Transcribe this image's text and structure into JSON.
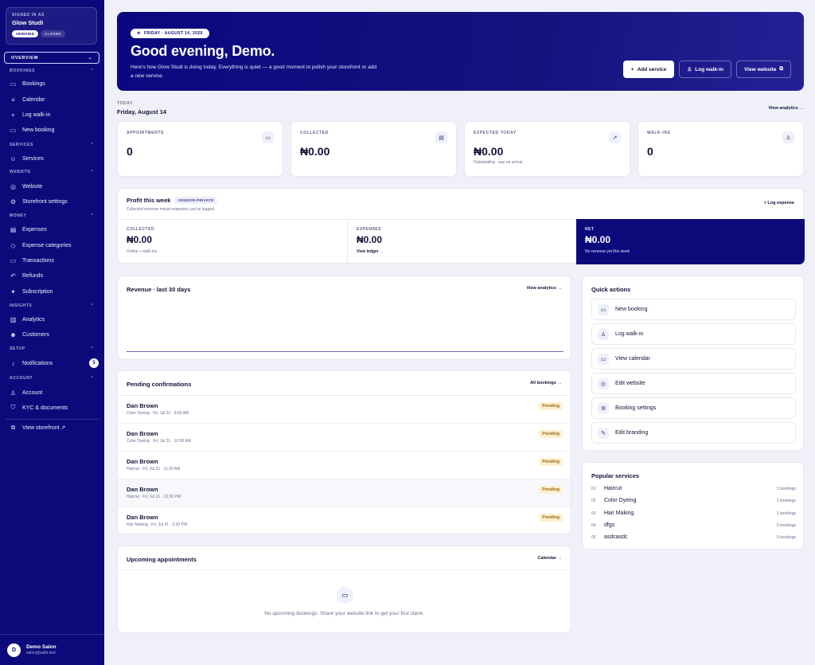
{
  "sidebar": {
    "signed_in_label": "SIGNED IN AS",
    "store_name": "Glow Studi",
    "verified": "VERIFIED",
    "closed": "CLOSED",
    "overview": "OVERVIEW",
    "sections": {
      "bookings": "BOOKINGS",
      "services": "SERVICES",
      "website": "WEBSITE",
      "money": "MONEY",
      "insights": "INSIGHTS",
      "setup": "SETUP",
      "account": "ACCOUNT"
    },
    "items": {
      "bookings": "Bookings",
      "calendar": "Calendar",
      "log_walkin": "Log walk-in",
      "new_booking": "New booking",
      "services": "Services",
      "website": "Website",
      "storefront_settings": "Storefront settings",
      "expenses": "Expenses",
      "expense_categories": "Expense categories",
      "transactions": "Transactions",
      "refunds": "Refunds",
      "subscription": "Subscription",
      "analytics": "Analytics",
      "customers": "Customers",
      "notifications": "Notifications",
      "notifications_count": "5",
      "account": "Account",
      "kyc": "KYC & documents",
      "view_storefront": "View storefront ↗"
    },
    "user": {
      "initial": "D",
      "name": "Demo Salon",
      "email": "salon@salbi.test"
    }
  },
  "hero": {
    "date": "FRIDAY · AUGUST 14, 2026",
    "greeting": "Good evening, Demo.",
    "message": "Here's how Glow Studi is doing today. Everything is quiet — a good moment to polish your storefront or add a new service.",
    "add_service": "Add service",
    "log_walkin": "Log walk-in",
    "view_website": "View website"
  },
  "today": {
    "label": "TODAY",
    "date": "Friday, August 14",
    "view_analytics": "View analytics →"
  },
  "stats": [
    {
      "label": "APPOINTMENTS",
      "value": "0",
      "sub": "",
      "icon": "calendar-icon"
    },
    {
      "label": "COLLECTED",
      "value": "₦0.00",
      "sub": "",
      "icon": "wallet-icon"
    },
    {
      "label": "EXPECTED TODAY",
      "value": "₦0.00",
      "sub": "Outstanding · pay on arrival",
      "icon": "trend-icon"
    },
    {
      "label": "WALK-INS",
      "value": "0",
      "sub": "",
      "icon": "user-plus-icon"
    }
  ],
  "profit": {
    "title": "Profit this week",
    "tag": "VENDOR-PRIVATE",
    "subtitle": "Collected revenue minus expenses you've logged.",
    "log_expense": "+ Log expense",
    "collected_label": "COLLECTED",
    "collected_value": "₦0.00",
    "collected_sub": "Online + walk-ins",
    "expenses_label": "EXPENSES",
    "expenses_value": "₦0.00",
    "expenses_link": "View ledger →",
    "net_label": "NET",
    "net_value": "₦0.00",
    "net_sub": "No revenue yet this week"
  },
  "revenue": {
    "title": "Revenue · last 30 days",
    "link": "View analytics →"
  },
  "pending": {
    "title": "Pending confirmations",
    "link": "All bookings →",
    "rows": [
      {
        "name": "Dan Brown",
        "detail": "Color Dyeing · Fri, Jul 31 · 9:00 AM",
        "status": "Pending"
      },
      {
        "name": "Dan Brown",
        "detail": "Color Dyeing · Fri, Jul 31 · 10:00 AM",
        "status": "Pending"
      },
      {
        "name": "Dan Brown",
        "detail": "Haircut · Fri, Jul 31 · 11:30 AM",
        "status": "Pending"
      },
      {
        "name": "Dan Brown",
        "detail": "Haircut · Fri, Jul 31 · 12:30 PM",
        "status": "Pending"
      },
      {
        "name": "Dan Brown",
        "detail": "Hair Making · Fri, Jul 31 · 2:30 PM",
        "status": "Pending"
      }
    ]
  },
  "upcoming": {
    "title": "Upcoming appointments",
    "link": "Calendar →",
    "empty": "No upcoming bookings. Share your website link to get your first client."
  },
  "quick_actions": {
    "title": "Quick actions",
    "items": [
      {
        "label": "New booking",
        "icon": "calendar-icon"
      },
      {
        "label": "Log walk-in",
        "icon": "user-plus-icon"
      },
      {
        "label": "View calendar",
        "icon": "calendar-icon"
      },
      {
        "label": "Edit website",
        "icon": "globe-icon"
      },
      {
        "label": "Booking settings",
        "icon": "gear-icon"
      },
      {
        "label": "Edit branding",
        "icon": "brush-icon"
      }
    ]
  },
  "popular": {
    "title": "Popular services",
    "items": [
      {
        "no": "01",
        "name": "Haircut",
        "count": "3 bookings"
      },
      {
        "no": "02",
        "name": "Color Dyeing",
        "count": "2 bookings"
      },
      {
        "no": "03",
        "name": "Hair Making",
        "count": "1 bookings"
      },
      {
        "no": "04",
        "name": "dfgs",
        "count": "0 bookings"
      },
      {
        "no": "05",
        "name": "asdcasdc",
        "count": "0 bookings"
      }
    ]
  },
  "colors": {
    "brand": "#0c0a7a",
    "bg": "#f0f1f8",
    "pending_bg": "#fdf0cf"
  }
}
